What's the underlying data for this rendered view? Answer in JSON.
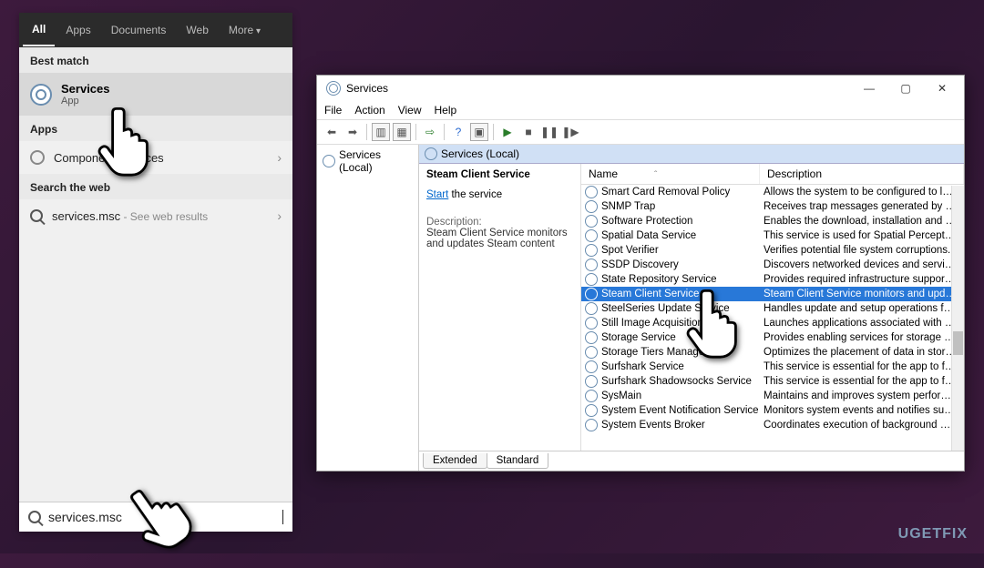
{
  "start": {
    "tabs": [
      "All",
      "Apps",
      "Documents",
      "Web",
      "More"
    ],
    "best_header": "Best match",
    "best_title": "Services",
    "best_sub": "App",
    "apps_header": "Apps",
    "comp": "Component Services",
    "web_header": "Search the web",
    "web_query": "services.msc",
    "web_hint": " - See web results",
    "search_value": "services.msc"
  },
  "win": {
    "title": "Services",
    "menu": [
      "File",
      "Action",
      "View",
      "Help"
    ],
    "tree_root": "Services (Local)",
    "main_head": "Services (Local)",
    "detail_name": "Steam Client Service",
    "start_link": "Start",
    "start_rest": " the service",
    "desc_label": "Description:",
    "desc_text": "Steam Client Service monitors and updates Steam content",
    "col_name": "Name",
    "col_desc": "Description",
    "tabs": {
      "extended": "Extended",
      "standard": "Standard"
    }
  },
  "services": [
    {
      "n": "Smart Card Removal Policy",
      "d": "Allows the system to be configured to lock th..."
    },
    {
      "n": "SNMP Trap",
      "d": "Receives trap messages generated by local or ..."
    },
    {
      "n": "Software Protection",
      "d": "Enables the download, installation and enforc..."
    },
    {
      "n": "Spatial Data Service",
      "d": "This service is used for Spatial Perception sce..."
    },
    {
      "n": "Spot Verifier",
      "d": "Verifies potential file system corruptions."
    },
    {
      "n": "SSDP Discovery",
      "d": "Discovers networked devices and services tha..."
    },
    {
      "n": "State Repository Service",
      "d": "Provides required infrastructure support for t..."
    },
    {
      "n": "Steam Client Service",
      "d": "Steam Client Service monitors and updates St...",
      "sel": true
    },
    {
      "n": "SteelSeries Update Service",
      "d": "Handles update and setup operations for Stee..."
    },
    {
      "n": "Still Image Acquisition Even",
      "d": "Launches applications associated with still im..."
    },
    {
      "n": "Storage Service",
      "d": "Provides enabling services for storage setting..."
    },
    {
      "n": "Storage Tiers Management",
      "d": "Optimizes the placement of data in storage ti..."
    },
    {
      "n": "Surfshark Service",
      "d": "This service is essential for the app to functio..."
    },
    {
      "n": "Surfshark Shadowsocks Service",
      "d": "This service is essential for the app to functio..."
    },
    {
      "n": "SysMain",
      "d": "Maintains and improves system performance..."
    },
    {
      "n": "System Event Notification Service",
      "d": "Monitors system events and notifies subscrib..."
    },
    {
      "n": "System Events Broker",
      "d": "Coordinates execution of background work f..."
    }
  ],
  "watermark": "UGETFIX"
}
